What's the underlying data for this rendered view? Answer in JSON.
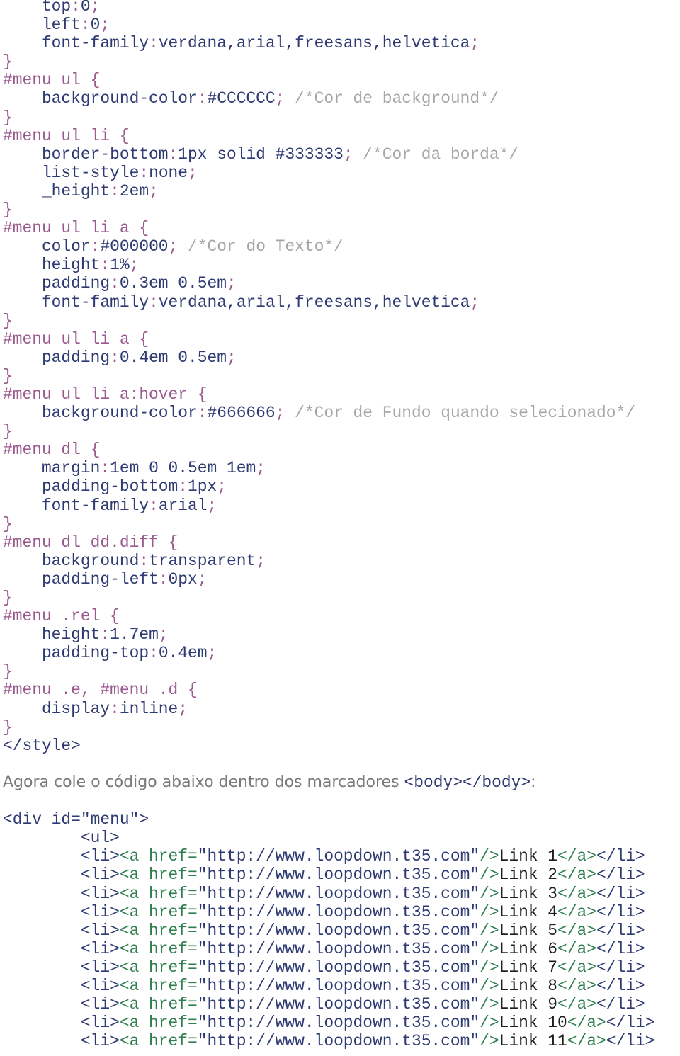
{
  "css_lines": [
    [
      [
        "c-prop",
        "    top"
      ],
      [
        "c-punc",
        ":"
      ],
      [
        "c-prop",
        "0"
      ],
      [
        "c-punc",
        ";"
      ]
    ],
    [
      [
        "c-prop",
        "    left"
      ],
      [
        "c-punc",
        ":"
      ],
      [
        "c-prop",
        "0"
      ],
      [
        "c-punc",
        ";"
      ]
    ],
    [
      [
        "c-prop",
        "    font-family"
      ],
      [
        "c-punc",
        ":"
      ],
      [
        "c-prop",
        "verdana,arial,freesans,helvetica"
      ],
      [
        "c-punc",
        ";"
      ]
    ],
    [
      [
        "c-sel",
        "}"
      ]
    ],
    [
      [
        "c-sel",
        "#menu ul {"
      ]
    ],
    [
      [
        "c-prop",
        "    background-color"
      ],
      [
        "c-punc",
        ":"
      ],
      [
        "c-prop",
        "#CCCCCC"
      ],
      [
        "c-punc",
        "; "
      ],
      [
        "c-cmt",
        "/*Cor de background*/"
      ]
    ],
    [
      [
        "c-sel",
        "}"
      ]
    ],
    [
      [
        "c-sel",
        "#menu ul li {"
      ]
    ],
    [
      [
        "c-prop",
        "    border-bottom"
      ],
      [
        "c-punc",
        ":"
      ],
      [
        "c-prop",
        "1px solid #333333"
      ],
      [
        "c-punc",
        "; "
      ],
      [
        "c-cmt",
        "/*Cor da borda*/"
      ]
    ],
    [
      [
        "c-prop",
        "    list-style"
      ],
      [
        "c-punc",
        ":"
      ],
      [
        "c-prop",
        "none"
      ],
      [
        "c-punc",
        ";"
      ]
    ],
    [
      [
        "c-prop",
        "    _height"
      ],
      [
        "c-punc",
        ":"
      ],
      [
        "c-prop",
        "2em"
      ],
      [
        "c-punc",
        ";"
      ]
    ],
    [
      [
        "c-sel",
        "}"
      ]
    ],
    [
      [
        "c-sel",
        "#menu ul li a {"
      ]
    ],
    [
      [
        "c-prop",
        "    color"
      ],
      [
        "c-punc",
        ":"
      ],
      [
        "c-prop",
        "#000000"
      ],
      [
        "c-punc",
        "; "
      ],
      [
        "c-cmt",
        "/*Cor do Texto*/"
      ]
    ],
    [
      [
        "c-prop",
        "    height"
      ],
      [
        "c-punc",
        ":"
      ],
      [
        "c-prop",
        "1%"
      ],
      [
        "c-punc",
        ";"
      ]
    ],
    [
      [
        "c-prop",
        "    padding"
      ],
      [
        "c-punc",
        ":"
      ],
      [
        "c-prop",
        "0.3em 0.5em"
      ],
      [
        "c-punc",
        ";"
      ]
    ],
    [
      [
        "c-prop",
        "    font-family"
      ],
      [
        "c-punc",
        ":"
      ],
      [
        "c-prop",
        "verdana,arial,freesans,helvetica"
      ],
      [
        "c-punc",
        ";"
      ]
    ],
    [
      [
        "c-sel",
        "}"
      ]
    ],
    [
      [
        "c-sel",
        "#menu ul li a {"
      ]
    ],
    [
      [
        "c-prop",
        "    padding"
      ],
      [
        "c-punc",
        ":"
      ],
      [
        "c-prop",
        "0.4em 0.5em"
      ],
      [
        "c-punc",
        ";"
      ]
    ],
    [
      [
        "c-sel",
        "}"
      ]
    ],
    [
      [
        "c-sel",
        "#menu ul li a:hover {"
      ]
    ],
    [
      [
        "c-prop",
        "    background-color"
      ],
      [
        "c-punc",
        ":"
      ],
      [
        "c-prop",
        "#666666"
      ],
      [
        "c-punc",
        "; "
      ],
      [
        "c-cmt",
        "/*Cor de Fundo quando selecionado*/"
      ]
    ],
    [
      [
        "c-sel",
        "}"
      ]
    ],
    [
      [
        "c-sel",
        "#menu dl {"
      ]
    ],
    [
      [
        "c-prop",
        "    margin"
      ],
      [
        "c-punc",
        ":"
      ],
      [
        "c-prop",
        "1em 0 0.5em 1em"
      ],
      [
        "c-punc",
        ";"
      ]
    ],
    [
      [
        "c-prop",
        "    padding-bottom"
      ],
      [
        "c-punc",
        ":"
      ],
      [
        "c-prop",
        "1px"
      ],
      [
        "c-punc",
        ";"
      ]
    ],
    [
      [
        "c-prop",
        "    font-family"
      ],
      [
        "c-punc",
        ":"
      ],
      [
        "c-prop",
        "arial"
      ],
      [
        "c-punc",
        ";"
      ]
    ],
    [
      [
        "c-sel",
        "}"
      ]
    ],
    [
      [
        "c-sel",
        "#menu dl dd.diff {"
      ]
    ],
    [
      [
        "c-prop",
        "    background"
      ],
      [
        "c-punc",
        ":"
      ],
      [
        "c-prop",
        "transparent"
      ],
      [
        "c-punc",
        ";"
      ]
    ],
    [
      [
        "c-prop",
        "    padding-left"
      ],
      [
        "c-punc",
        ":"
      ],
      [
        "c-prop",
        "0px"
      ],
      [
        "c-punc",
        ";"
      ]
    ],
    [
      [
        "c-sel",
        "}"
      ]
    ],
    [
      [
        "c-sel",
        "#menu .rel {"
      ]
    ],
    [
      [
        "c-prop",
        "    height"
      ],
      [
        "c-punc",
        ":"
      ],
      [
        "c-prop",
        "1.7em"
      ],
      [
        "c-punc",
        ";"
      ]
    ],
    [
      [
        "c-prop",
        "    padding-top"
      ],
      [
        "c-punc",
        ":"
      ],
      [
        "c-prop",
        "0.4em"
      ],
      [
        "c-punc",
        ";"
      ]
    ],
    [
      [
        "c-sel",
        "}"
      ]
    ],
    [
      [
        "c-sel",
        "#menu .e, #menu .d {"
      ]
    ],
    [
      [
        "c-prop",
        "    display"
      ],
      [
        "c-punc",
        ":"
      ],
      [
        "c-prop",
        "inline"
      ],
      [
        "c-punc",
        ";"
      ]
    ],
    [
      [
        "c-sel",
        "}"
      ]
    ],
    [
      [
        "c-tag",
        "</style>"
      ]
    ]
  ],
  "instruction": {
    "text": "Agora cole o código abaixo dentro dos marcadores ",
    "code": "<body></body>",
    "suffix": ":"
  },
  "html_lines": [
    [
      [
        "c-tag",
        "<div id=\"menu\">"
      ]
    ],
    [
      [
        "c-tag",
        "        <ul>"
      ]
    ]
  ],
  "link_lines": [
    [
      [
        "c-tag",
        "        <li>"
      ],
      [
        "c-attr",
        "<a href="
      ],
      [
        "c-str",
        "\"http://www.loopdown.t35.com\""
      ],
      [
        "c-attr",
        "/>"
      ],
      [
        "c-text",
        "Link 1"
      ],
      [
        "c-attr",
        "</a>"
      ],
      [
        "c-tag",
        "</li>"
      ]
    ],
    [
      [
        "c-tag",
        "        <li>"
      ],
      [
        "c-attr",
        "<a href="
      ],
      [
        "c-str",
        "\"http://www.loopdown.t35.com\""
      ],
      [
        "c-attr",
        "/>"
      ],
      [
        "c-text",
        "Link 2"
      ],
      [
        "c-attr",
        "</a>"
      ],
      [
        "c-tag",
        "</li>"
      ]
    ],
    [
      [
        "c-tag",
        "        <li>"
      ],
      [
        "c-attr",
        "<a href="
      ],
      [
        "c-str",
        "\"http://www.loopdown.t35.com\""
      ],
      [
        "c-attr",
        "/>"
      ],
      [
        "c-text",
        "Link 3"
      ],
      [
        "c-attr",
        "</a>"
      ],
      [
        "c-tag",
        "</li>"
      ]
    ],
    [
      [
        "c-tag",
        "        <li>"
      ],
      [
        "c-attr",
        "<a href="
      ],
      [
        "c-str",
        "\"http://www.loopdown.t35.com\""
      ],
      [
        "c-attr",
        "/>"
      ],
      [
        "c-text",
        "Link 4"
      ],
      [
        "c-attr",
        "</a>"
      ],
      [
        "c-tag",
        "</li>"
      ]
    ],
    [
      [
        "c-tag",
        "        <li>"
      ],
      [
        "c-attr",
        "<a href="
      ],
      [
        "c-str",
        "\"http://www.loopdown.t35.com\""
      ],
      [
        "c-attr",
        "/>"
      ],
      [
        "c-text",
        "Link 5"
      ],
      [
        "c-attr",
        "</a>"
      ],
      [
        "c-tag",
        "</li>"
      ]
    ],
    [
      [
        "c-tag",
        "        <li>"
      ],
      [
        "c-attr",
        "<a href="
      ],
      [
        "c-str",
        "\"http://www.loopdown.t35.com\""
      ],
      [
        "c-attr",
        "/>"
      ],
      [
        "c-text",
        "Link 6"
      ],
      [
        "c-attr",
        "</a>"
      ],
      [
        "c-tag",
        "</li>"
      ]
    ],
    [
      [
        "c-tag",
        "        <li>"
      ],
      [
        "c-attr",
        "<a href="
      ],
      [
        "c-str",
        "\"http://www.loopdown.t35.com\""
      ],
      [
        "c-attr",
        "/>"
      ],
      [
        "c-text",
        "Link 7"
      ],
      [
        "c-attr",
        "</a>"
      ],
      [
        "c-tag",
        "</li>"
      ]
    ],
    [
      [
        "c-tag",
        "        <li>"
      ],
      [
        "c-attr",
        "<a href="
      ],
      [
        "c-str",
        "\"http://www.loopdown.t35.com\""
      ],
      [
        "c-attr",
        "/>"
      ],
      [
        "c-text",
        "Link 8"
      ],
      [
        "c-attr",
        "</a>"
      ],
      [
        "c-tag",
        "</li>"
      ]
    ],
    [
      [
        "c-tag",
        "        <li>"
      ],
      [
        "c-attr",
        "<a href="
      ],
      [
        "c-str",
        "\"http://www.loopdown.t35.com\""
      ],
      [
        "c-attr",
        "/>"
      ],
      [
        "c-text",
        "Link 9"
      ],
      [
        "c-attr",
        "</a>"
      ],
      [
        "c-tag",
        "</li>"
      ]
    ],
    [
      [
        "c-tag",
        "        <li>"
      ],
      [
        "c-attr",
        "<a href="
      ],
      [
        "c-str",
        "\"http://www.loopdown.t35.com\""
      ],
      [
        "c-attr",
        "/>"
      ],
      [
        "c-text",
        "Link 10"
      ],
      [
        "c-attr",
        "</a>"
      ],
      [
        "c-tag",
        "</li>"
      ]
    ],
    [
      [
        "c-tag",
        "        <li>"
      ],
      [
        "c-attr",
        "<a href="
      ],
      [
        "c-str",
        "\"http://www.loopdown.t35.com\""
      ],
      [
        "c-attr",
        "/>"
      ],
      [
        "c-text",
        "Link 11"
      ],
      [
        "c-attr",
        "</a>"
      ],
      [
        "c-tag",
        "</li>"
      ]
    ]
  ]
}
